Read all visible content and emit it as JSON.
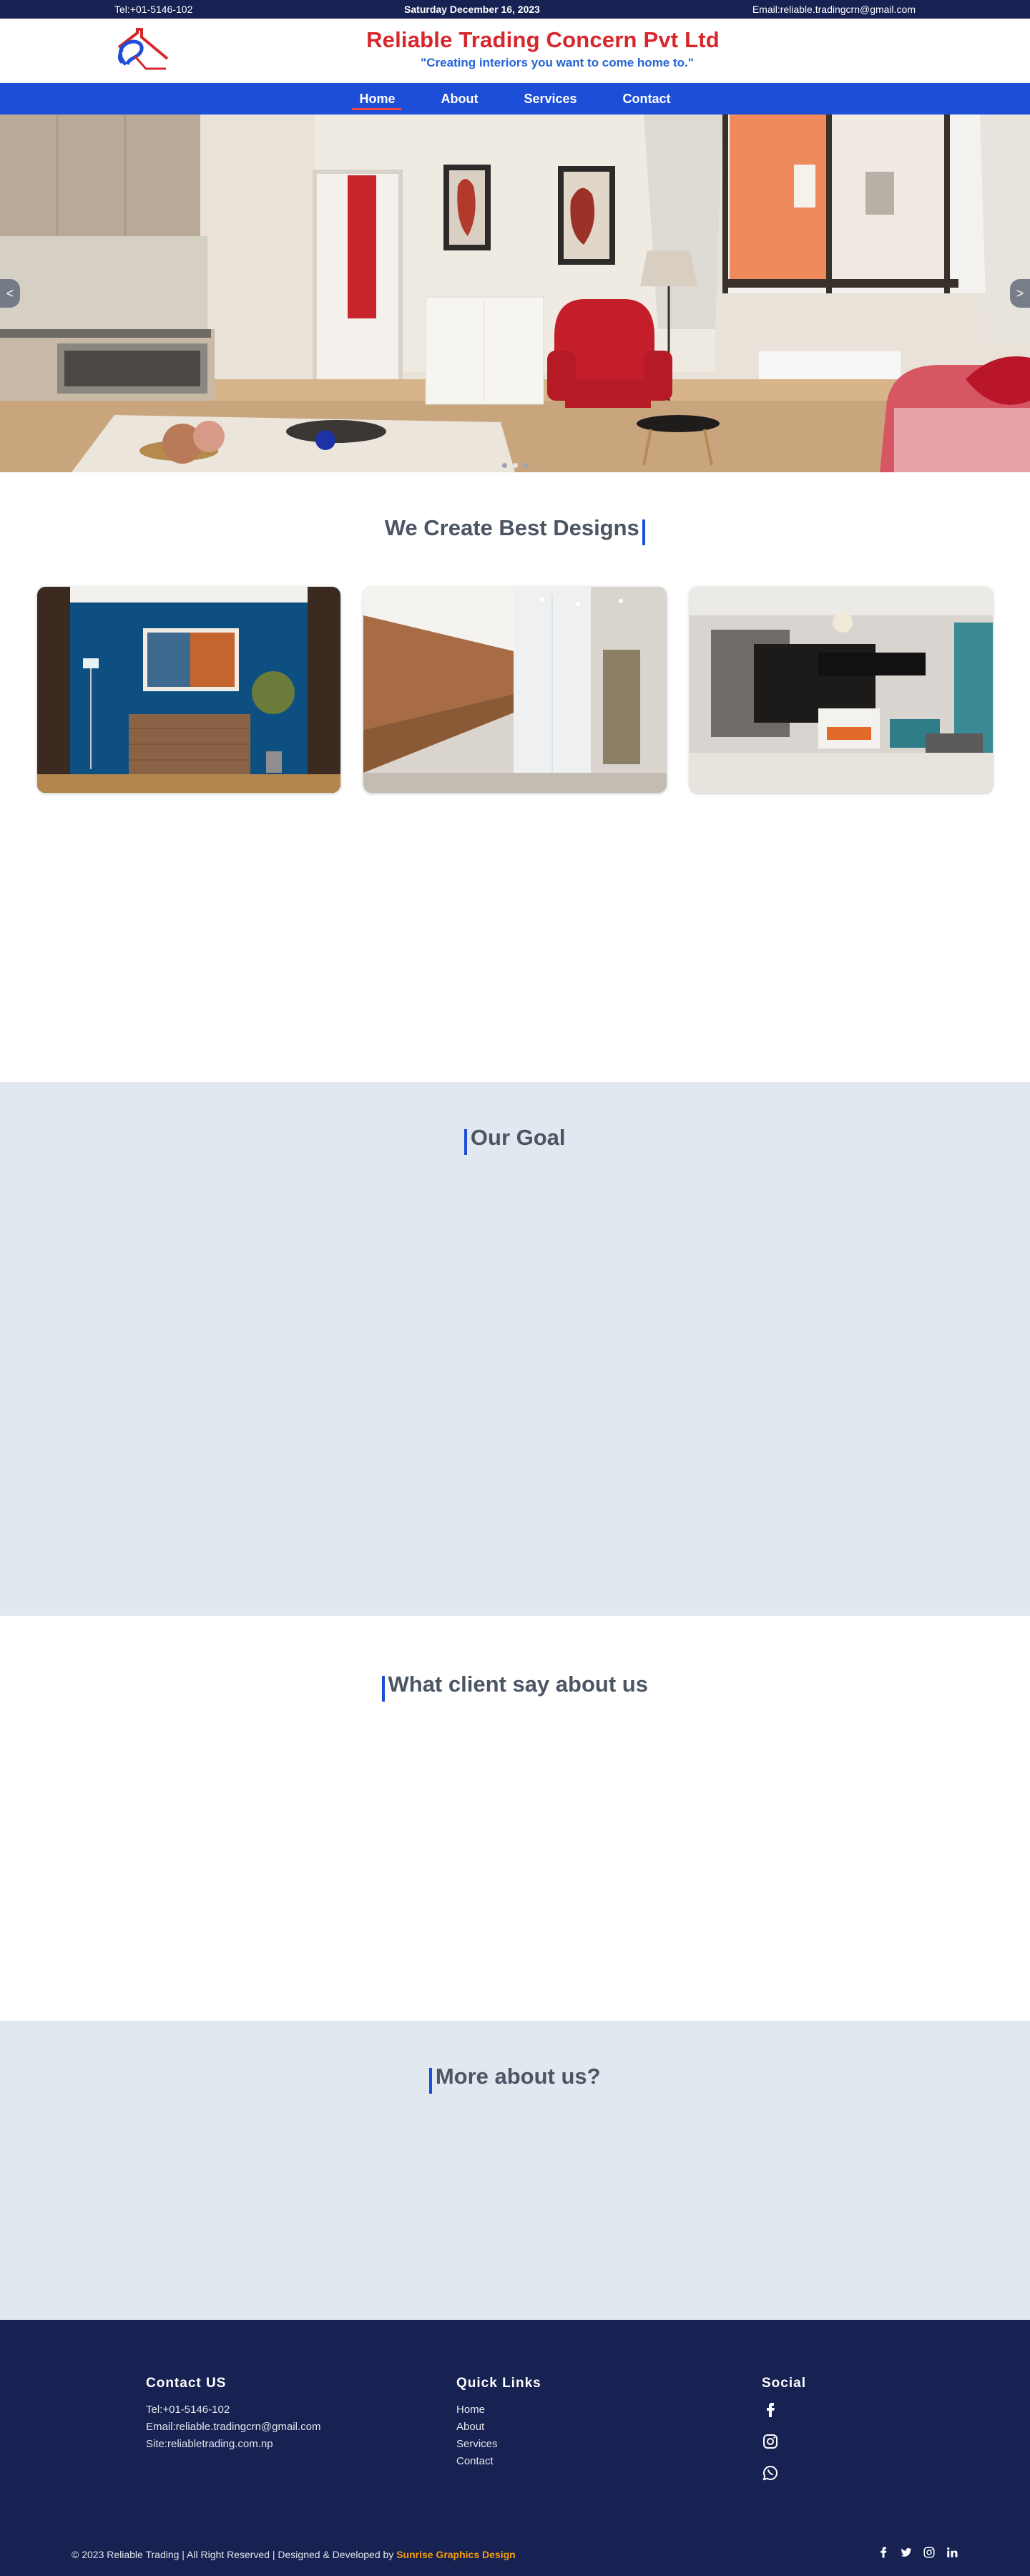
{
  "topbar": {
    "tel": "Tel:+01-5146-102",
    "date": "Saturday December 16, 2023",
    "email": "Email:reliable.tradingcrn@gmail.com"
  },
  "header": {
    "company": "Reliable Trading Concern Pvt Ltd",
    "tagline": "\"Creating interiors you want to come home to.\""
  },
  "nav": {
    "items": [
      {
        "label": "Home",
        "active": true
      },
      {
        "label": "About"
      },
      {
        "label": "Services"
      },
      {
        "label": "Contact"
      }
    ]
  },
  "hero": {
    "prev": "<",
    "next": ">",
    "slides": 3,
    "active_slide": 2
  },
  "sections": {
    "designs_title": "We Create Best Designs",
    "goal_title": "Our Goal",
    "clients_title": "What client say about us",
    "more_title": "More about us?"
  },
  "footer": {
    "contact_title": "Contact US",
    "contact_tel": "Tel:+01-5146-102",
    "contact_email": "Email:reliable.tradingcrn@gmail.com",
    "contact_site": "Site:reliabletrading.com.np",
    "links_title": "Quick Links",
    "links": [
      "Home",
      "About",
      "Services",
      "Contact"
    ],
    "social_title": "Social",
    "social_icons": [
      "facebook-icon",
      "instagram-icon",
      "whatsapp-icon"
    ],
    "copyright": "© 2023 Reliable Trading | All Right Reserved | Designed & Developed by",
    "developer": "Sunrise Graphics Design",
    "bottom_icons": [
      "facebook-icon",
      "twitter-icon",
      "instagram-icon",
      "linkedin-icon"
    ]
  },
  "colors": {
    "topbar": "#172152",
    "nav": "#1d4ed8",
    "brand_red": "#d7262c",
    "tagline_blue": "#2563d6",
    "section_gray": "#e2e8f0",
    "accent_orange": "#f59e0b"
  }
}
